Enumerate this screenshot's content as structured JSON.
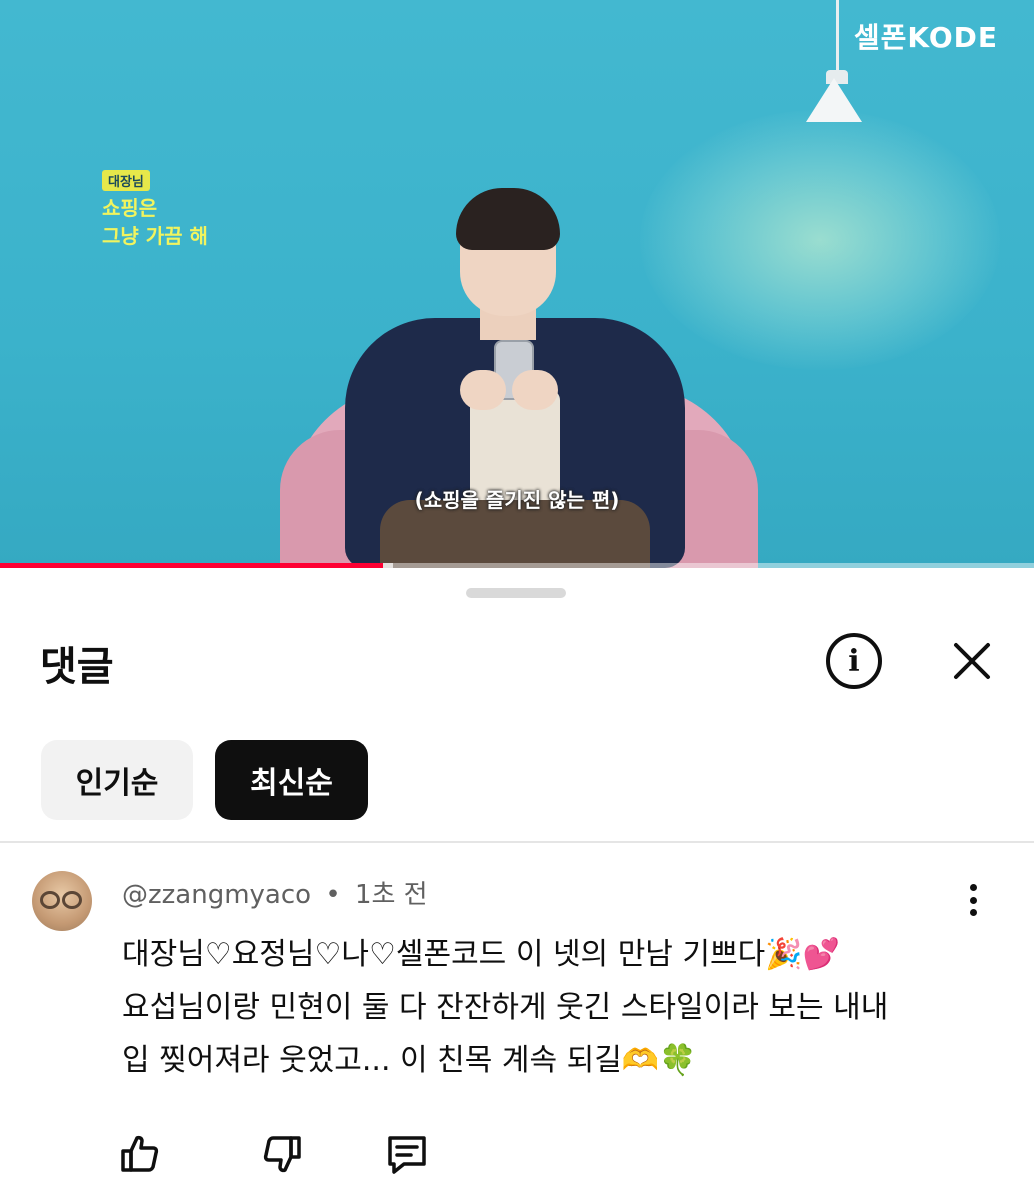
{
  "video": {
    "brand_logo": "셀폰KODE",
    "overlay_badge": "대장님",
    "overlay_line1": "쇼핑은",
    "overlay_line2": "그냥 가끔 해",
    "subtitle": "(쇼핑을 즐기진 않는 편)",
    "progress_fraction": 0.37,
    "buffer_fraction": 0.38,
    "progress_color": "#ff0033"
  },
  "sheet": {
    "title": "댓글",
    "info_icon": "info-icon",
    "close_icon": "close-icon",
    "filters": [
      {
        "label": "인기순",
        "selected": false
      },
      {
        "label": "최신순",
        "selected": true
      }
    ]
  },
  "comment": {
    "author": "@zzangmyaco",
    "separator": "•",
    "time": "1초 전",
    "lines": [
      "대장님♡요정님♡나♡셀폰코드 이 넷의 만남 기쁘다🎉💕",
      "요섭님이랑 민현이 둘 다 잔잔하게 웃긴 스타일이라 보는 내내",
      "입 찢어져라 웃었고... 이 친목 계속 되길🫶🍀"
    ],
    "actions": [
      "thumbs-up-icon",
      "thumbs-down-icon",
      "reply-icon"
    ]
  }
}
